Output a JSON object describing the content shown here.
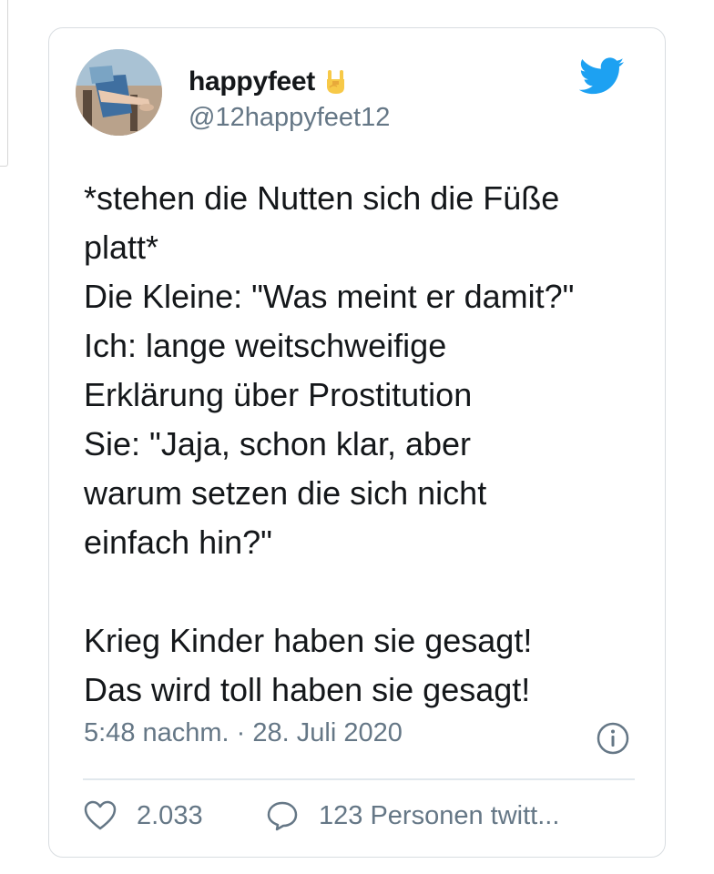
{
  "tweet": {
    "display_name": "happyfeet",
    "handle": "@12happyfeet12",
    "text": "*stehen die Nutten sich die Füße\nplatt*\nDie Kleine: \"Was meint er damit?\"\nIch: lange weitschweifige\nErklärung über Prostitution\nSie: \"Jaja, schon klar, aber\nwarum setzen die sich nicht\neinfach hin?\"\n\nKrieg Kinder haben sie gesagt!\nDas wird toll haben sie gesagt!",
    "timestamp": "5:48 nachm. · 28. Juli 2020",
    "likes": "2.033",
    "replies_label": "123 Personen twitt..."
  },
  "icons": {
    "brand": "twitter-bird-icon",
    "name_emoji": "sign-of-the-horns-icon",
    "info": "info-icon",
    "like": "heart-icon",
    "reply": "speech-bubble-icon"
  },
  "colors": {
    "twitter_blue": "#1da1f2",
    "text": "#14171a",
    "secondary": "#657786",
    "border": "#d9dde1"
  }
}
